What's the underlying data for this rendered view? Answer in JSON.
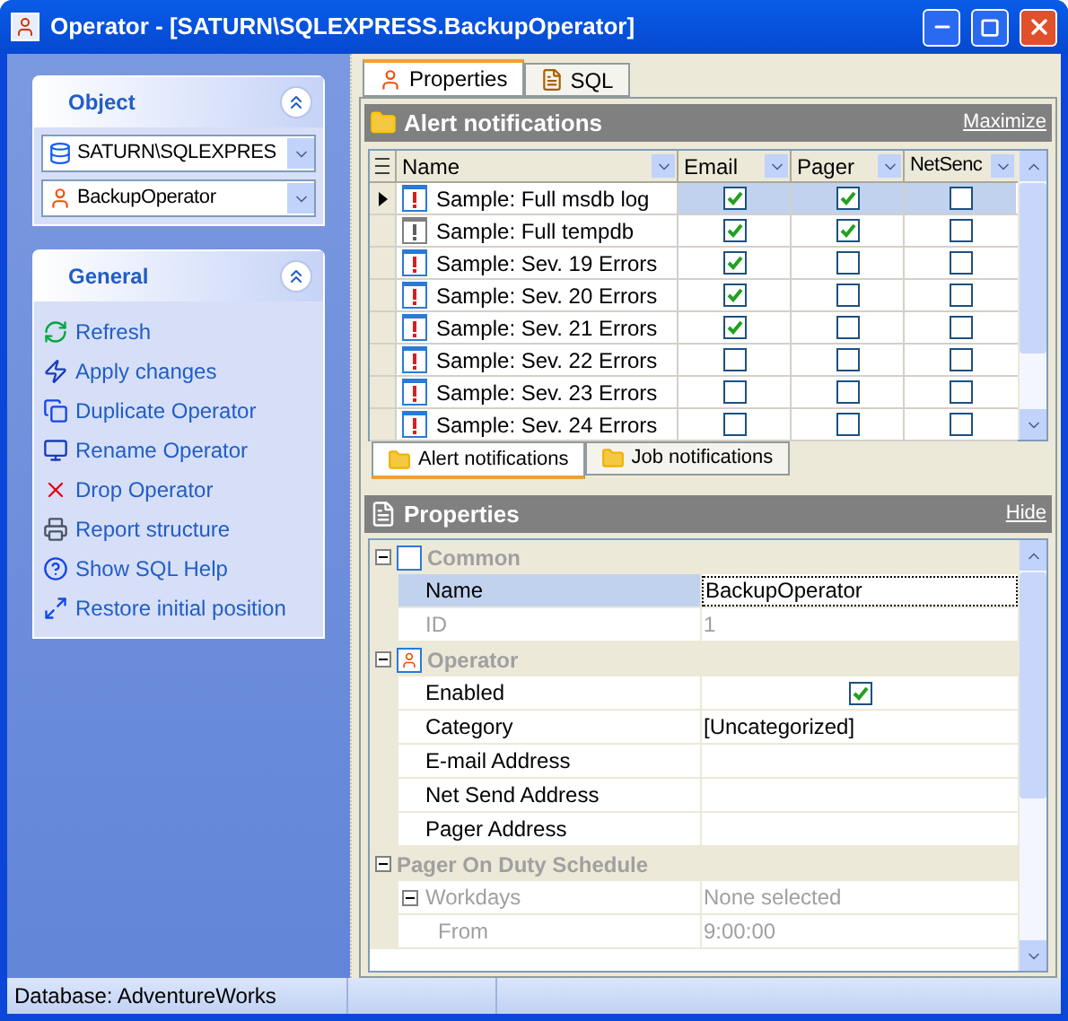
{
  "window": {
    "title": "Operator - [SATURN\\SQLEXPRESS.BackupOperator]"
  },
  "sidebar": {
    "sections": [
      {
        "kind": "object",
        "title": "Object",
        "expanded": true,
        "combos": [
          {
            "value": "SATURN\\SQLEXPRES"
          },
          {
            "value": "BackupOperator"
          }
        ]
      },
      {
        "kind": "actions",
        "title": "General",
        "expanded": true,
        "items": [
          {
            "label": "Refresh"
          },
          {
            "label": "Apply changes"
          },
          {
            "label": "Duplicate Operator"
          },
          {
            "label": "Rename Operator"
          },
          {
            "label": "Drop Operator"
          },
          {
            "label": "Report structure"
          },
          {
            "label": "Show SQL Help"
          },
          {
            "label": "Restore initial position"
          }
        ]
      }
    ]
  },
  "tabs": [
    {
      "label": "Properties",
      "selected": true
    },
    {
      "label": "SQL",
      "selected": false
    }
  ],
  "alert_panel": {
    "title": "Alert notifications",
    "action": "Maximize",
    "columns": [
      "Name",
      "Email",
      "Pager",
      "NetSenc"
    ],
    "rows": [
      {
        "name": "Sample: Full msdb log",
        "enabled": true,
        "email": true,
        "pager": true,
        "netsend": false,
        "selected": true
      },
      {
        "name": "Sample: Full tempdb",
        "enabled": false,
        "email": true,
        "pager": true,
        "netsend": false,
        "selected": false
      },
      {
        "name": "Sample: Sev. 19 Errors",
        "enabled": true,
        "email": true,
        "pager": false,
        "netsend": false,
        "selected": false
      },
      {
        "name": "Sample: Sev. 20 Errors",
        "enabled": true,
        "email": true,
        "pager": false,
        "netsend": false,
        "selected": false
      },
      {
        "name": "Sample: Sev. 21 Errors",
        "enabled": true,
        "email": true,
        "pager": false,
        "netsend": false,
        "selected": false
      },
      {
        "name": "Sample: Sev. 22 Errors",
        "enabled": true,
        "email": false,
        "pager": false,
        "netsend": false,
        "selected": false
      },
      {
        "name": "Sample: Sev. 23 Errors",
        "enabled": true,
        "email": false,
        "pager": false,
        "netsend": false,
        "selected": false
      },
      {
        "name": "Sample: Sev. 24 Errors",
        "enabled": true,
        "email": false,
        "pager": false,
        "netsend": false,
        "selected": false
      }
    ]
  },
  "bottom_tabs": [
    {
      "label": "Alert notifications",
      "selected": true
    },
    {
      "label": "Job notifications",
      "selected": false
    }
  ],
  "properties_panel": {
    "title": "Properties",
    "action": "Hide",
    "categories": [
      {
        "label": "Common",
        "icon": true,
        "expanded": true,
        "children": [
          {
            "kind": "text",
            "label": "Name",
            "value": "BackupOperator",
            "selected": true,
            "disabled": false
          },
          {
            "kind": "text",
            "label": "ID",
            "value": "1",
            "selected": false,
            "disabled": true
          }
        ]
      },
      {
        "label": "Operator",
        "icon": true,
        "expanded": true,
        "children": [
          {
            "kind": "checkbox",
            "label": "Enabled",
            "checked": true,
            "selected": false,
            "disabled": false
          },
          {
            "kind": "text",
            "label": "Category",
            "value": "[Uncategorized]",
            "selected": false,
            "disabled": false
          },
          {
            "kind": "text",
            "label": "E-mail Address",
            "selected": false,
            "disabled": false
          },
          {
            "kind": "text",
            "label": "Net Send Address",
            "selected": false,
            "disabled": false
          },
          {
            "kind": "text",
            "label": "Pager Address",
            "selected": false,
            "disabled": false
          }
        ]
      },
      {
        "label": "Pager On Duty Schedule",
        "icon": false,
        "expanded": true,
        "children": [
          {
            "kind": "group",
            "label": "Workdays",
            "value": "None selected",
            "selected": false,
            "disabled": true,
            "expanded": true,
            "children": [
              {
                "kind": "text",
                "label": "From",
                "value": "9:00:00",
                "selected": false,
                "disabled": true
              }
            ]
          }
        ]
      }
    ]
  },
  "status_bar": [
    "Database: AdventureWorks"
  ]
}
